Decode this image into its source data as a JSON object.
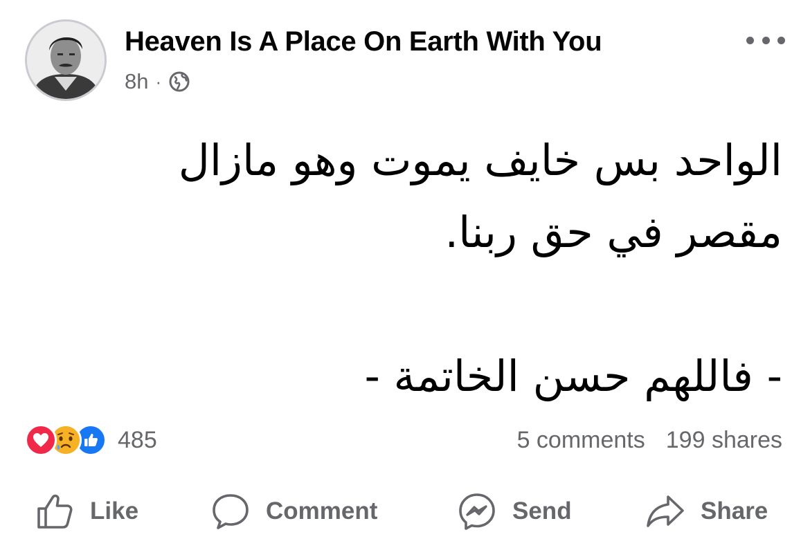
{
  "post": {
    "author": "Heaven Is A Place On Earth With You",
    "time": "8h",
    "separator": "·",
    "privacy_icon": "globe-icon",
    "menu_icon": "more-horizontal-icon",
    "text_lines": [
      "الواحد بس خايف يموت وهو مازال",
      "مقصر في حق ربنا.",
      "",
      "- فاللهم حسن الخاتمة -"
    ]
  },
  "reactions": {
    "icons": [
      "love-reaction-icon",
      "sad-reaction-icon",
      "like-reaction-icon"
    ],
    "count": "485"
  },
  "stats": {
    "comments": "5 comments",
    "shares": "199 shares"
  },
  "actions": {
    "like": "Like",
    "comment": "Comment",
    "send": "Send",
    "share": "Share"
  },
  "colors": {
    "text": "#050505",
    "secondary": "#65676b",
    "love": "#f02849",
    "sad": "#f7b125",
    "like": "#1877f2"
  }
}
